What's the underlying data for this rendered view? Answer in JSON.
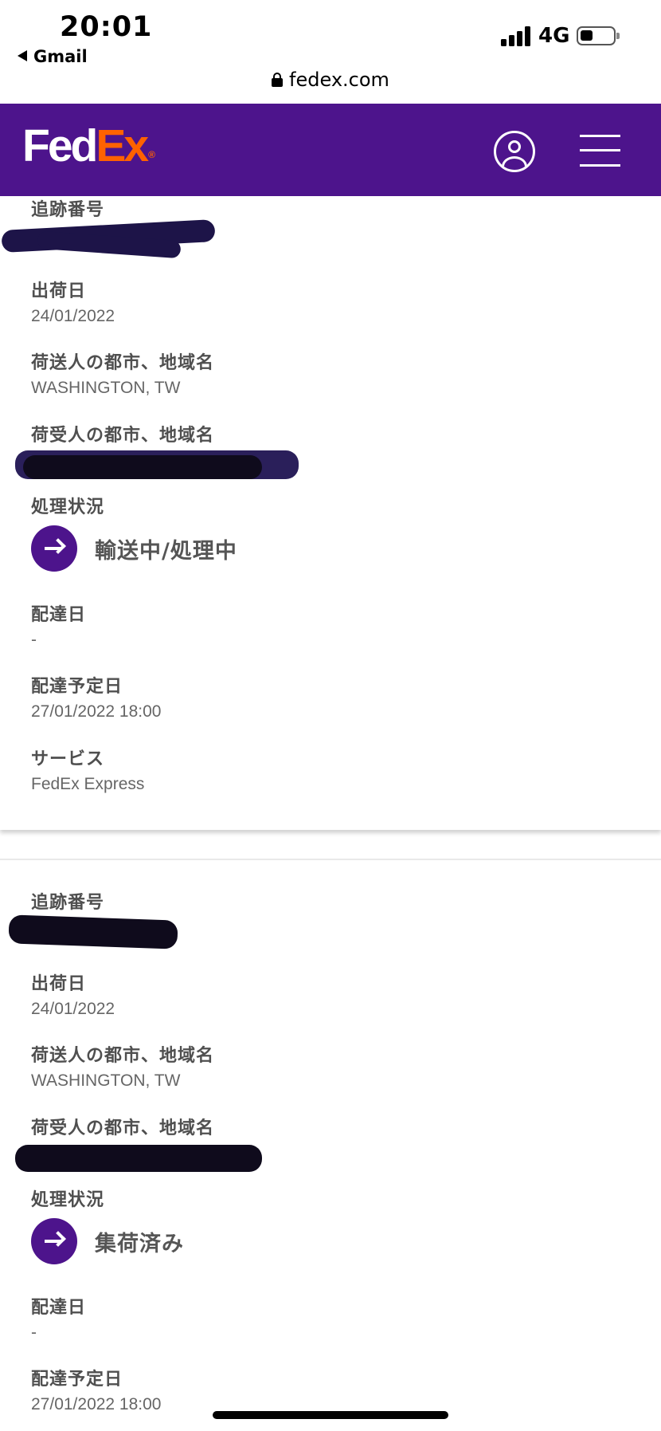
{
  "status_bar": {
    "time": "20:01",
    "back_app": "Gmail",
    "network": "4G"
  },
  "browser": {
    "url": "fedex.com"
  },
  "header": {
    "logo_fed": "Fed",
    "logo_ex": "Ex",
    "logo_reg": "®",
    "brand_purple": "#4d148c",
    "brand_orange": "#ff6200"
  },
  "shipments": [
    {
      "tracking_label": "追跡番号",
      "ship_date_label": "出荷日",
      "ship_date": "24/01/2022",
      "shipper_label": "荷送人の都市、地域名",
      "shipper": "WASHINGTON, TW",
      "recipient_label": "荷受人の都市、地域名",
      "status_label": "処理状況",
      "status": "輸送中/処理中",
      "delivery_date_label": "配達日",
      "delivery_date": "-",
      "scheduled_label": "配達予定日",
      "scheduled": "27/01/2022 18:00",
      "service_label": "サービス",
      "service": "FedEx Express"
    },
    {
      "tracking_label": "追跡番号",
      "ship_date_label": "出荷日",
      "ship_date": "24/01/2022",
      "shipper_label": "荷送人の都市、地域名",
      "shipper": "WASHINGTON, TW",
      "recipient_label": "荷受人の都市、地域名",
      "status_label": "処理状況",
      "status": "集荷済み",
      "delivery_date_label": "配達日",
      "delivery_date": "-",
      "scheduled_label": "配達予定日",
      "scheduled": "27/01/2022 18:00"
    }
  ]
}
